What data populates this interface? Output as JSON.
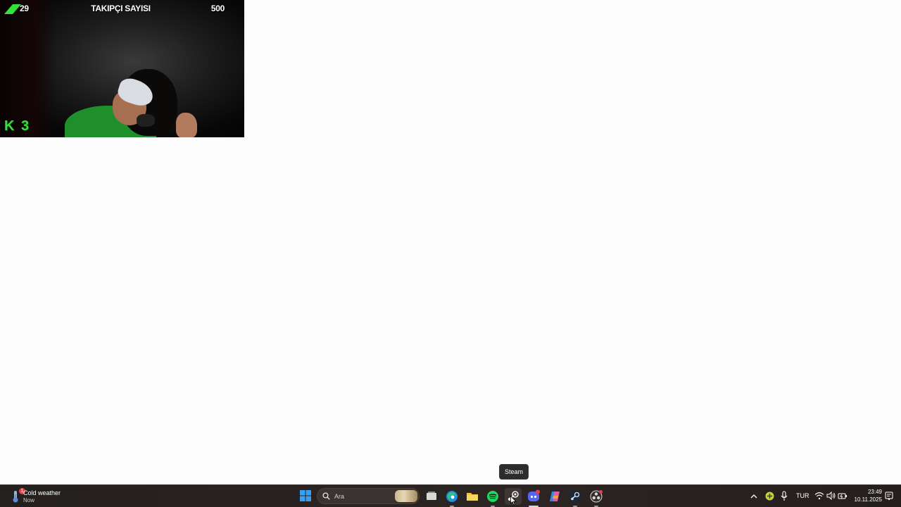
{
  "webcam": {
    "left_value": "29",
    "title": "TAKIPÇI SAYISI",
    "right_value": "500",
    "logo_text": "K 3"
  },
  "tooltip": {
    "text": "Steam"
  },
  "taskbar": {
    "weather": {
      "title": "Cold weather",
      "subtitle": "Now",
      "badge": "1"
    },
    "search": {
      "placeholder": "Ara"
    },
    "apps": [
      {
        "name": "Task View",
        "icon": "task-view-icon"
      },
      {
        "name": "Microsoft Edge",
        "icon": "edge-icon"
      },
      {
        "name": "File Explorer",
        "icon": "folder-icon"
      },
      {
        "name": "Spotify",
        "icon": "spotify-icon"
      },
      {
        "name": "Steam",
        "icon": "steam-icon",
        "hovered": true
      },
      {
        "name": "Discord",
        "icon": "discord-icon",
        "badge": "9+"
      },
      {
        "name": "Copilot",
        "icon": "copilot-icon"
      },
      {
        "name": "Steam",
        "icon": "steam-icon"
      },
      {
        "name": "OBS Studio",
        "icon": "obs-icon"
      }
    ],
    "tray": {
      "language": "TUR",
      "time": "23:49",
      "date": "10.11.2025"
    }
  },
  "colors": {
    "taskbar_bg": "#2a2321",
    "webcam_accent": "#34e03c",
    "spotify": "#1ed760",
    "discord": "#5865f2"
  }
}
